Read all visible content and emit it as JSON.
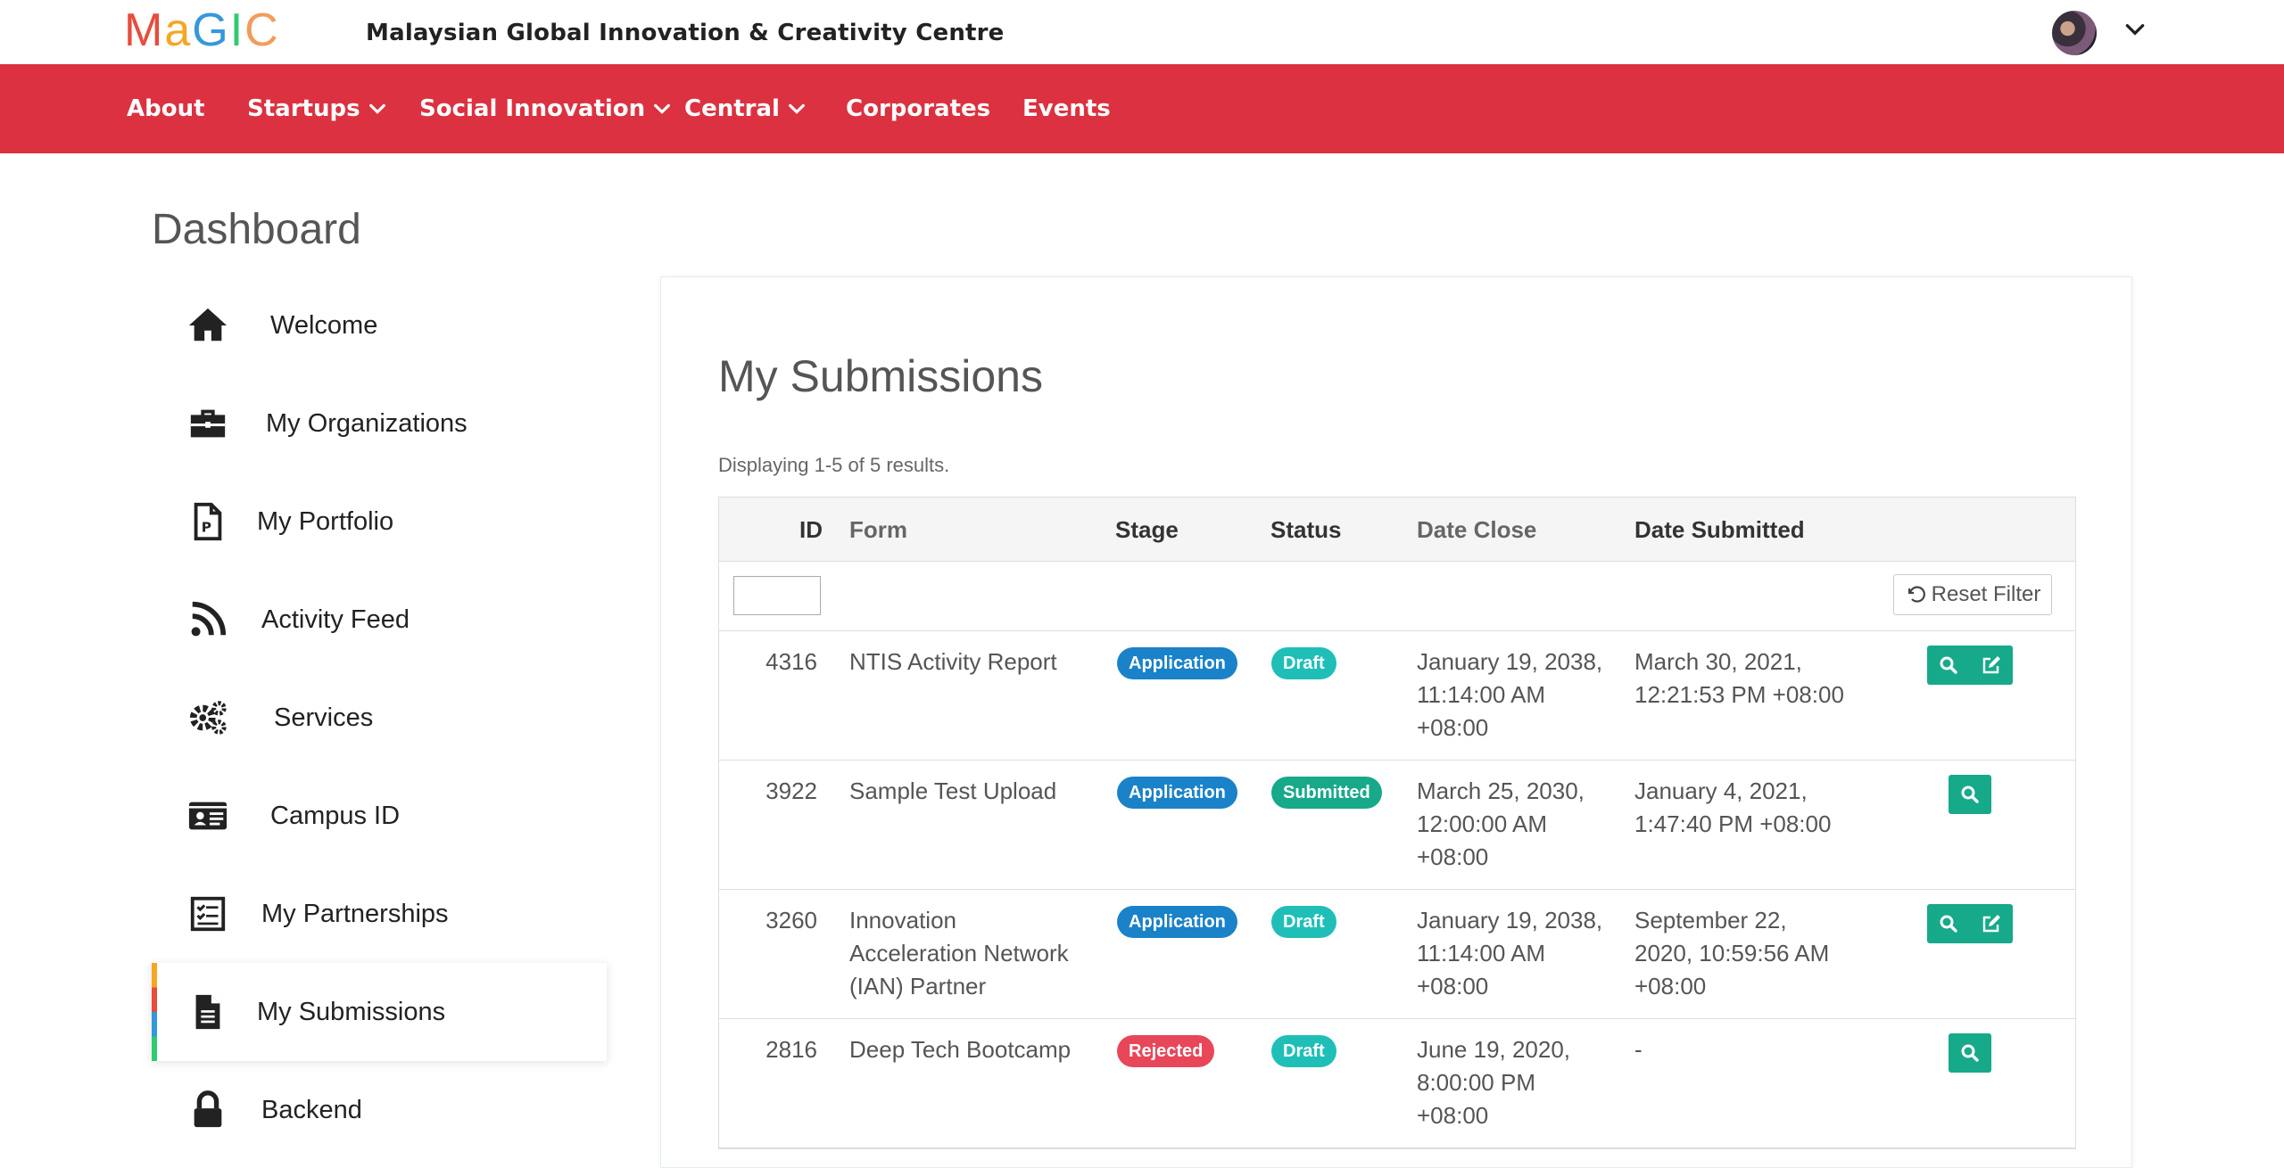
{
  "brand": {
    "logo_letters": [
      {
        "ch": "M",
        "color": "#e74c3c"
      },
      {
        "ch": "a",
        "color": "#f5a623"
      },
      {
        "ch": "G",
        "color": "#3498db"
      },
      {
        "ch": "I",
        "color": "#2ecc71"
      },
      {
        "ch": "C",
        "color": "#f39c5a"
      }
    ],
    "name": "Malaysian Global Innovation & Creativity Centre"
  },
  "nav": {
    "color": "#dc3140",
    "items": [
      {
        "label": "About"
      },
      {
        "label": "Startups"
      },
      {
        "label": "Social Innovation"
      },
      {
        "label": "Central"
      },
      {
        "label": "Corporates"
      },
      {
        "label": "Events"
      }
    ]
  },
  "sidebar": {
    "title": "Dashboard",
    "items": [
      {
        "label": "Welcome",
        "icon": "home-icon"
      },
      {
        "label": "My Organizations",
        "icon": "briefcase-icon"
      },
      {
        "label": "My Portfolio",
        "icon": "portfolio-file-icon"
      },
      {
        "label": "Activity Feed",
        "icon": "rss-icon"
      },
      {
        "label": "Services",
        "icon": "gears-icon"
      },
      {
        "label": "Campus ID",
        "icon": "id-card-icon"
      },
      {
        "label": "My Partnerships",
        "icon": "checklist-icon"
      },
      {
        "label": "My Submissions",
        "icon": "document-icon",
        "active": true
      },
      {
        "label": "Backend",
        "icon": "lock-icon"
      }
    ]
  },
  "main": {
    "title": "My Submissions",
    "summary": "Displaying 1-5 of 5 results.",
    "columns": {
      "id": "ID",
      "form": "Form",
      "stage": "Stage",
      "status": "Status",
      "date_close": "Date Close",
      "date_submitted": "Date Submitted"
    },
    "reset_filter": "Reset Filter",
    "colors": {
      "application": "#1a82c8",
      "rejected": "#e8475a",
      "draft": "#1fbfb8",
      "submitted": "#17a98a",
      "action": "#16a98a"
    },
    "rows": [
      {
        "id": "4316",
        "form": "NTIS Activity Report",
        "stage": "Application",
        "status": "Draft",
        "date_close": [
          "January 19, 2038,",
          "11:14:00 AM",
          "+08:00"
        ],
        "date_submitted": [
          "March 30, 2021,",
          "12:21:53 PM +08:00"
        ],
        "actions": [
          "view",
          "edit"
        ]
      },
      {
        "id": "3922",
        "form": "Sample Test Upload",
        "stage": "Application",
        "status": "Submitted",
        "date_close": [
          "March 25, 2030,",
          "12:00:00 AM",
          "+08:00"
        ],
        "date_submitted": [
          "January 4, 2021,",
          "1:47:40 PM +08:00"
        ],
        "actions": [
          "view"
        ]
      },
      {
        "id": "3260",
        "form": [
          "Innovation",
          "Acceleration Network",
          "(IAN) Partner"
        ],
        "stage": "Application",
        "status": "Draft",
        "date_close": [
          "January 19, 2038,",
          "11:14:00 AM",
          "+08:00"
        ],
        "date_submitted": [
          "September 22,",
          "2020, 10:59:56 AM",
          "+08:00"
        ],
        "actions": [
          "view",
          "edit"
        ]
      },
      {
        "id": "2816",
        "form": "Deep Tech Bootcamp",
        "stage": "Rejected",
        "status": "Draft",
        "date_close": [
          "June 19, 2020,",
          "8:00:00 PM",
          "+08:00"
        ],
        "date_submitted": [
          "-"
        ],
        "actions": [
          "view"
        ]
      }
    ]
  }
}
